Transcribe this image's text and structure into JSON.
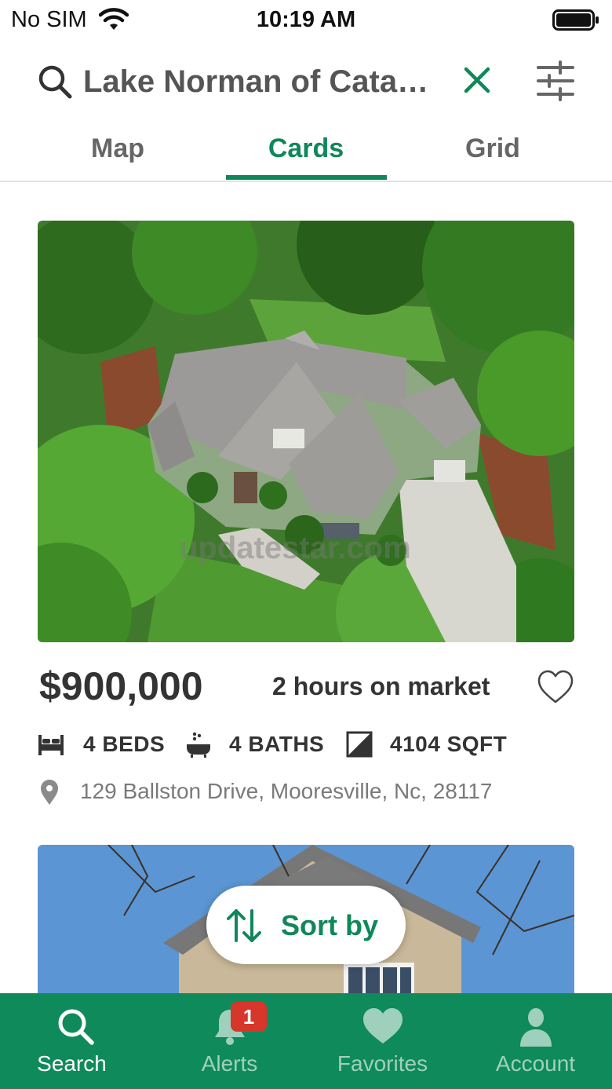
{
  "status_bar": {
    "carrier": "No SIM",
    "time": "10:19 AM"
  },
  "search": {
    "query": "Lake Norman of Catawba"
  },
  "tabs": [
    {
      "label": "Map",
      "active": false
    },
    {
      "label": "Cards",
      "active": true
    },
    {
      "label": "Grid",
      "active": false
    }
  ],
  "listing": {
    "price": "$900,000",
    "time_on_market": "2 hours on market",
    "beds": "4 BEDS",
    "baths": "4 BATHS",
    "sqft": "4104 SQFT",
    "address": "129 Ballston Drive, Mooresville, Nc, 28117",
    "watermark": "updatestar.com"
  },
  "sort": {
    "label": "Sort by"
  },
  "bottom_nav": {
    "items": [
      {
        "label": "Search",
        "icon": "search-icon",
        "active": true
      },
      {
        "label": "Alerts",
        "icon": "bell-icon",
        "active": false,
        "badge": "1"
      },
      {
        "label": "Favorites",
        "icon": "heart-icon",
        "active": false
      },
      {
        "label": "Account",
        "icon": "person-icon",
        "active": false
      }
    ]
  },
  "colors": {
    "accent": "#10875a",
    "nav_background": "#0f8a5b",
    "badge": "#d7362b"
  }
}
